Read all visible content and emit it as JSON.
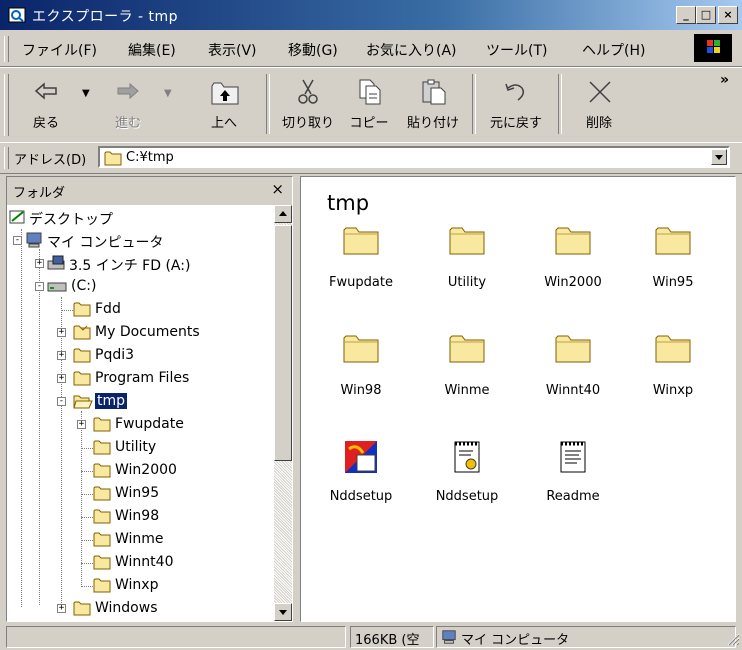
{
  "window": {
    "title": "エクスプローラ - tmp",
    "minimize": "_",
    "maximize": "□",
    "close": "×"
  },
  "menu": [
    "ファイル(F)",
    "編集(E)",
    "表示(V)",
    "移動(G)",
    "お気に入り(A)",
    "ツール(T)",
    "ヘルプ(H)"
  ],
  "toolbar": {
    "back": "戻る",
    "forward": "進む",
    "up": "上へ",
    "cut": "切り取り",
    "copy": "コピー",
    "paste": "貼り付け",
    "undo": "元に戻す",
    "delete": "削除",
    "more": "»"
  },
  "address": {
    "label": "アドレス(D)",
    "value": "C:¥tmp"
  },
  "folder_pane": {
    "title": "フォルダ",
    "close": "×",
    "tree": [
      {
        "label": "デスクトップ"
      },
      {
        "label": "マイ コンピュータ"
      },
      {
        "label": "3.5 インチ FD (A:)"
      },
      {
        "label": "(C:)"
      },
      {
        "label": "Fdd"
      },
      {
        "label": "My Documents"
      },
      {
        "label": "Pqdi3"
      },
      {
        "label": "Program Files"
      },
      {
        "label": "tmp"
      },
      {
        "label": "Fwupdate"
      },
      {
        "label": "Utility"
      },
      {
        "label": "Win2000"
      },
      {
        "label": "Win95"
      },
      {
        "label": "Win98"
      },
      {
        "label": "Winme"
      },
      {
        "label": "Winnt40"
      },
      {
        "label": "Winxp"
      },
      {
        "label": "Windows"
      }
    ]
  },
  "content": {
    "title": "tmp",
    "items": [
      {
        "label": "Fwupdate",
        "icon": "folder-icon"
      },
      {
        "label": "Utility",
        "icon": "folder-icon"
      },
      {
        "label": "Win2000",
        "icon": "folder-icon"
      },
      {
        "label": "Win95",
        "icon": "folder-icon"
      },
      {
        "label": "Win98",
        "icon": "folder-icon"
      },
      {
        "label": "Winme",
        "icon": "folder-icon"
      },
      {
        "label": "Winnt40",
        "icon": "folder-icon"
      },
      {
        "label": "Winxp",
        "icon": "folder-icon"
      },
      {
        "label": "Nddsetup",
        "icon": "setup-exe-icon"
      },
      {
        "label": "Nddsetup",
        "icon": "setup-ini-icon"
      },
      {
        "label": "Readme",
        "icon": "text-file-icon"
      }
    ]
  },
  "status": {
    "size": "166KB (空",
    "location": "マイ コンピュータ"
  },
  "colors": {
    "titlebar": "#0a246a",
    "face": "#d4d0c8",
    "selection": "#0a246a",
    "folder": "#f8e8a0"
  }
}
